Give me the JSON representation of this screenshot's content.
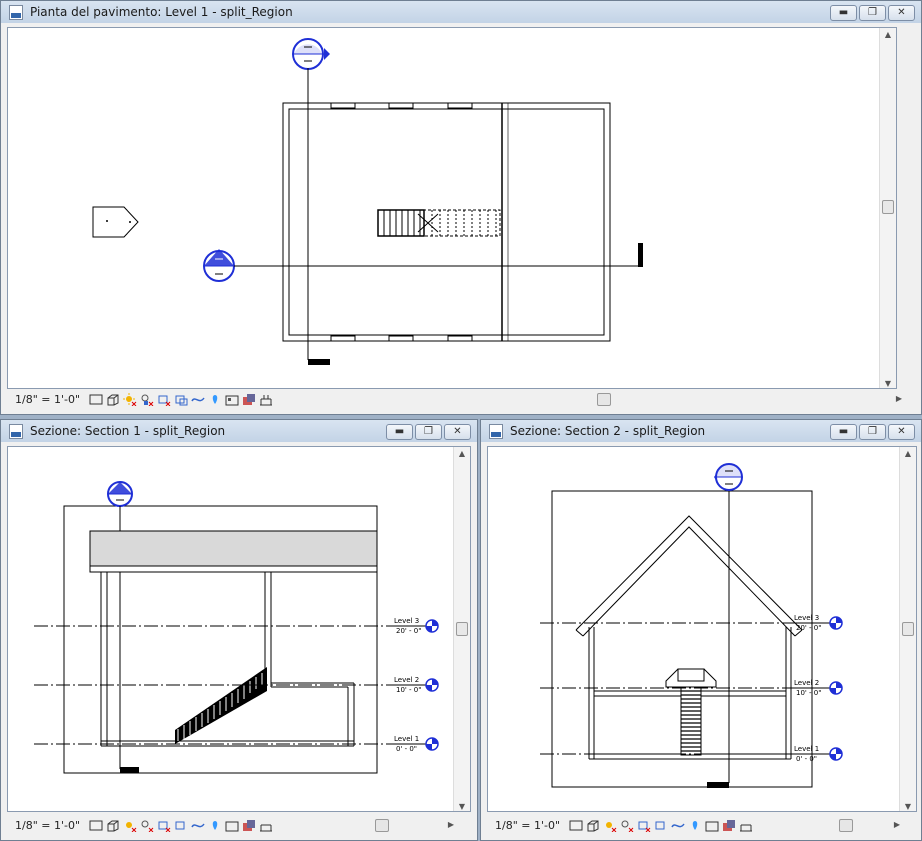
{
  "windows": {
    "floor_plan": {
      "title": "Pianta del pavimento: Level 1 - split_Region",
      "scale": "1/8\" = 1'-0\""
    },
    "section1": {
      "title": "Sezione: Section 1 - split_Region",
      "scale": "1/8\" = 1'-0\"",
      "levels": [
        {
          "name": "Level 3",
          "elev": "20' - 0\""
        },
        {
          "name": "Level 2",
          "elev": "10' - 0\""
        },
        {
          "name": "Level 1",
          "elev": "0' - 0\""
        }
      ]
    },
    "section2": {
      "title": "Sezione: Section 2 - split_Region",
      "scale": "1/8\" = 1'-0\"",
      "levels": [
        {
          "name": "Level 3",
          "elev": "20' - 0\""
        },
        {
          "name": "Level 2",
          "elev": "10' - 0\""
        },
        {
          "name": "Level 1",
          "elev": "0' - 0\""
        }
      ]
    }
  },
  "window_buttons": {
    "minimize": "▬",
    "restore": "❐",
    "close": "✕"
  },
  "view_tools": [
    "detail-level-icon",
    "visual-style-icon",
    "sun-path-icon",
    "shadows-icon",
    "crop-view-icon",
    "show-crop-icon",
    "temporary-hide-icon",
    "reveal-hidden-icon",
    "analytical-model-icon",
    "worksharing-icon",
    "design-options-icon",
    "highlight-displacement-icon"
  ],
  "colors": {
    "accent": "#1f2fd6",
    "background": "#9fb1c6",
    "titlebar": "#c9d7e8"
  }
}
